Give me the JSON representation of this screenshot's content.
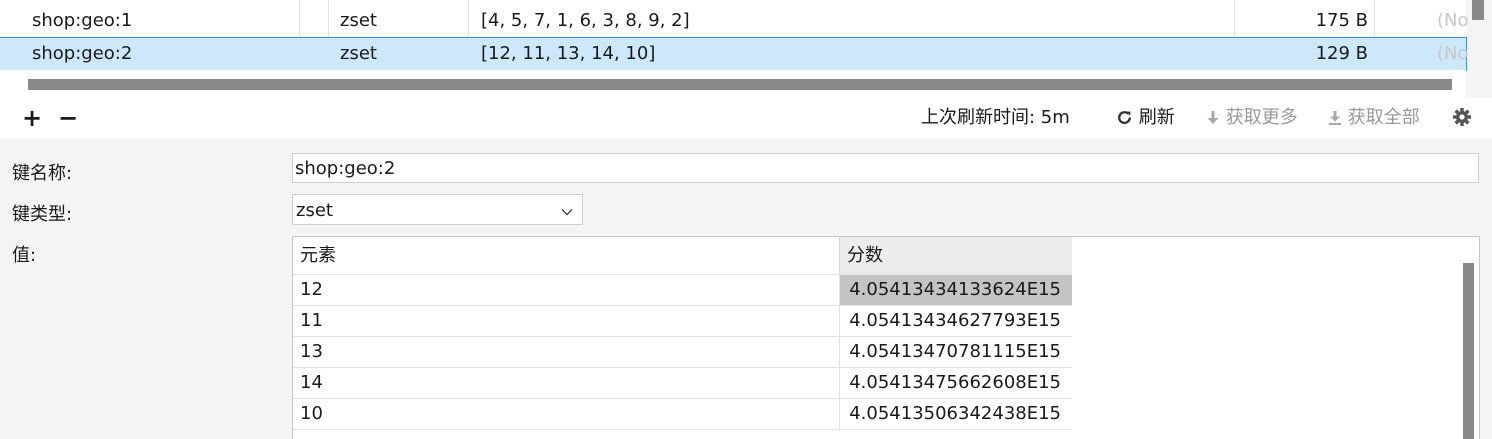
{
  "key_list": {
    "rows": [
      {
        "name": "shop:geo:1",
        "type": "zset",
        "value": "[4, 5, 7, 1, 6, 3, 8, 9, 2]",
        "size": "175 B",
        "ttl": "(No"
      },
      {
        "name": "shop:geo:2",
        "type": "zset",
        "value": "[12, 11, 13, 14, 10]",
        "size": "129 B",
        "ttl": "(No"
      }
    ]
  },
  "toolbar": {
    "add": "+",
    "remove": "−",
    "refresh_time": "上次刷新时间: 5m",
    "refresh": "刷新",
    "fetch_more": "获取更多",
    "fetch_all": "获取全部"
  },
  "detail": {
    "key_name_label": "键名称:",
    "key_name": "shop:geo:2",
    "key_type_label": "键类型:",
    "key_type": "zset",
    "value_label": "值:",
    "columns": [
      "元素",
      "分数"
    ],
    "members": [
      {
        "member": "12",
        "score": "4.05413434133624E15"
      },
      {
        "member": "11",
        "score": "4.05413434627793E15"
      },
      {
        "member": "13",
        "score": "4.05413470781115E15"
      },
      {
        "member": "14",
        "score": "4.05413475662608E15"
      },
      {
        "member": "10",
        "score": "4.05413506342438E15"
      }
    ]
  },
  "colors": {
    "selected_row": "#cde8fb",
    "selected_border": "#3d8fd6",
    "selected_cell": "#c4c4c4"
  },
  "icons": {
    "refresh": "refresh-icon",
    "fetch_more": "arrow-down-icon",
    "fetch_all": "download-icon",
    "settings": "gear-icon",
    "dropdown": "chevron-down-icon"
  }
}
